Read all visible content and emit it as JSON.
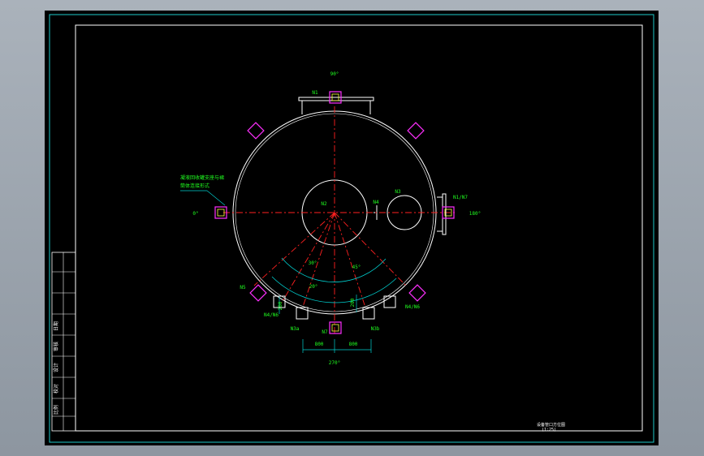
{
  "colors": {
    "background": "#000000",
    "frame": "#1ec8c8",
    "inner_frame": "#ffffff",
    "vessel": "#ffffff",
    "centerline": "#ff2020",
    "dimension": "#00d0d0",
    "label": "#20ff20",
    "nozzle": "#ff30ff"
  },
  "labels": {
    "deg_90": "90°",
    "deg_0": "0°",
    "deg_180": "180°",
    "deg_270": "270°",
    "n1": "N1",
    "n2": "N2",
    "n3": "N3",
    "n4": "N4",
    "n5": "N5",
    "n7": "N7",
    "n1_n7": "N1/N7",
    "n4_n6": "N4/N6",
    "n3a": "N3a",
    "n3b": "N3b",
    "angle_30": "30°",
    "angle_45": "45°",
    "angle_20": "20°",
    "dim_left": "800",
    "dim_right": "800",
    "dim_vert_left": "200",
    "dim_vert_right": "200",
    "note_line1": "凝液回收罐支座与裙",
    "note_line2": "筒体连接形式",
    "title_line1": "设备管口方位图",
    "title_line2": "(1:25)"
  },
  "title_block": {
    "rows": [
      "日期",
      "审核",
      "设计",
      "校对",
      "比例"
    ]
  }
}
